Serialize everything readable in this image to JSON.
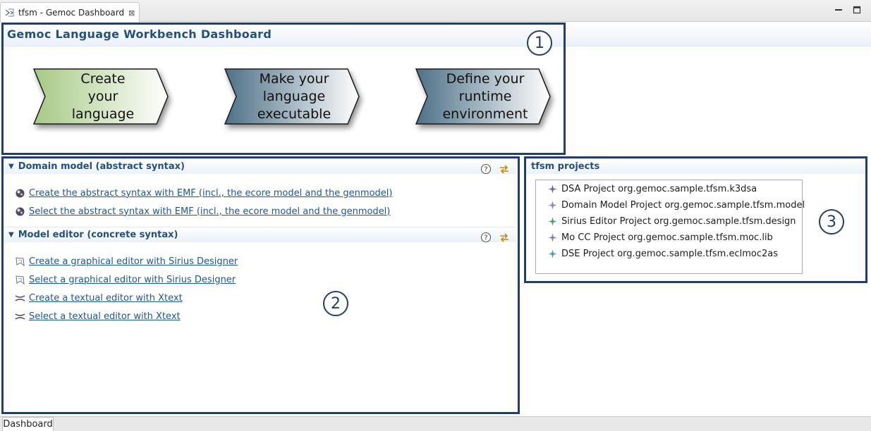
{
  "editor_tab": {
    "title": "tfsm - Gemoc Dashboard",
    "icon": "gemoc-dashboard-icon",
    "close_glyph": "⊠"
  },
  "window_controls": {
    "minimize_icon": "minimize-icon",
    "maximize_icon": "maximize-icon"
  },
  "header": {
    "title": "Gemoc Language Workbench Dashboard"
  },
  "steps": [
    {
      "label": "Create\nyour\nlanguage",
      "style": "green"
    },
    {
      "label": "Make your\nlanguage\nexecutable",
      "style": "steel"
    },
    {
      "label": "Define your\nruntime\nenvironment",
      "style": "steel"
    }
  ],
  "annotations": [
    "1",
    "2",
    "3"
  ],
  "domain_section": {
    "title": "Domain model (abstract syntax)",
    "links": [
      {
        "label": "Create the abstract syntax with EMF (incl., the ecore model and the genmodel)",
        "icon": "emf-icon"
      },
      {
        "label": "Select the abstract syntax with EMF (incl., the ecore model and the genmodel)",
        "icon": "emf-icon"
      }
    ]
  },
  "editor_section": {
    "title": "Model editor (concrete syntax)",
    "links": [
      {
        "label": "Create a graphical editor with Sirius Designer",
        "icon": "sirius-icon"
      },
      {
        "label": "Select a graphical editor with Sirius Designer",
        "icon": "sirius-icon"
      },
      {
        "label": "Create a textual editor with Xtext",
        "icon": "xtext-icon"
      },
      {
        "label": "Select a textual editor with Xtext",
        "icon": "xtext-icon"
      }
    ]
  },
  "projects_section": {
    "title": "tfsm projects",
    "items": [
      {
        "label": "DSA Project org.gemoc.sample.tfsm.k3dsa",
        "color": "#6a6a8a"
      },
      {
        "label": "Domain Model Project org.gemoc.sample.tfsm.model",
        "color": "#8a8aa8"
      },
      {
        "label": "Sirius Editor Project org.gemoc.sample.tfsm.design",
        "color": "#4f9a6c"
      },
      {
        "label": "Mo CC Project org.gemoc.sample.tfsm.moc.lib",
        "color": "#8a7aa8"
      },
      {
        "label": "DSE Project org.gemoc.sample.tfsm.eclmoc2as",
        "color": "#4f9a9a"
      }
    ]
  },
  "bottom_tab": {
    "label": "Dashboard"
  },
  "colors": {
    "title_blue": "#25507b",
    "link_blue": "#1e5598",
    "annotation_navy": "#223e6c",
    "chevron_green": "#a9cc87",
    "chevron_steel": "#507489"
  }
}
